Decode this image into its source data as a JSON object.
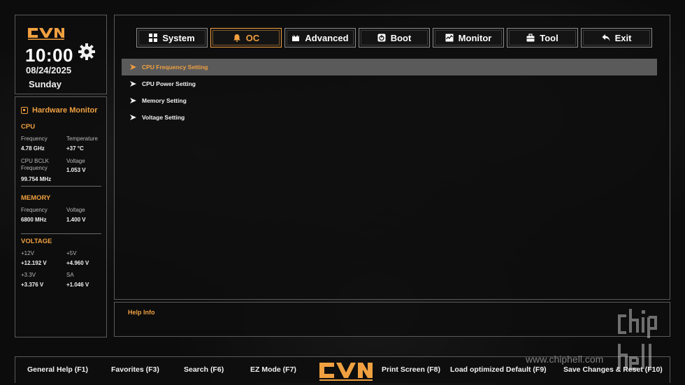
{
  "clock": {
    "time": "10:00",
    "date": "08/24/2025",
    "day": "Sunday"
  },
  "hardware_monitor": {
    "title": "Hardware Monitor",
    "cpu": {
      "heading": "CPU",
      "frequency_label": "Frequency",
      "frequency_value": "4.78 GHz",
      "temperature_label": "Temperature",
      "temperature_value": "+37 °C",
      "bclk_label_line1": "CPU BCLK",
      "bclk_label_line2": "Frequency",
      "bclk_value": "99.754 MHz",
      "voltage_label": "Voltage",
      "voltage_value": "1.053 V"
    },
    "memory": {
      "heading": "MEMORY",
      "frequency_label": "Frequency",
      "frequency_value": "6800 MHz",
      "voltage_label": "Voltage",
      "voltage_value": "1.400 V"
    },
    "voltage": {
      "heading": "VOLTAGE",
      "v12_label": "+12V",
      "v12_value": "+12.192 V",
      "v5_label": "+5V",
      "v5_value": "+4.960 V",
      "v33_label": "+3.3V",
      "v33_value": "+3.376 V",
      "sa_label": "SA",
      "sa_value": "+1.046 V"
    }
  },
  "tabs": [
    {
      "label": "System",
      "icon": "grid-icon"
    },
    {
      "label": "OC",
      "icon": "bell-icon",
      "active": true
    },
    {
      "label": "Advanced",
      "icon": "chip-icon"
    },
    {
      "label": "Boot",
      "icon": "power-icon"
    },
    {
      "label": "Monitor",
      "icon": "chart-icon"
    },
    {
      "label": "Tool",
      "icon": "toolbox-icon"
    },
    {
      "label": "Exit",
      "icon": "return-arrow-icon"
    }
  ],
  "menu_items": [
    {
      "label": "CPU Frequency Setting",
      "selected": true
    },
    {
      "label": "CPU Power Setting"
    },
    {
      "label": "Memory Setting"
    },
    {
      "label": "Voltage Setting"
    }
  ],
  "help": {
    "title": "Help Info"
  },
  "function_keys": {
    "general_help": "General Help (F1)",
    "favorites": "Favorites (F3)",
    "search": "Search (F6)",
    "ez_mode": "EZ Mode (F7)",
    "print_screen": "Print Screen (F8)",
    "load_default": "Load optimized Default (F9)",
    "save_reset": "Save Changes & Reset (F10)"
  },
  "watermark": {
    "url": "www.chiphell.com"
  },
  "colors": {
    "accent": "#f0a040",
    "selected_row": "#5a5a5a",
    "border": "#5a5a5a",
    "background": "#0c0c0c"
  }
}
